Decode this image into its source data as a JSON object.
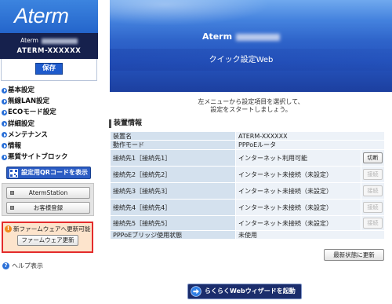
{
  "sidebar": {
    "logo": "Aterm",
    "device_brand": "Aterm",
    "device_id": "ATERM-XXXXXX",
    "save_label": "保存",
    "menu": [
      {
        "label": "基本設定",
        "icon": "circle-arrow-icon"
      },
      {
        "label": "無線LAN設定",
        "icon": "circle-arrow-icon"
      },
      {
        "label": "ECOモード設定",
        "icon": "circle-arrow-icon"
      },
      {
        "label": "詳細設定",
        "icon": "circle-arrow-icon"
      },
      {
        "label": "メンテナンス",
        "icon": "circle-arrow-icon"
      },
      {
        "label": "情報",
        "icon": "circle-arrow-icon"
      },
      {
        "label": "悪質サイトブロック",
        "icon": "circle-arrow-icon"
      }
    ],
    "qr_button": {
      "label": "設定用QRコードを表示",
      "icon": "qr-code-icon"
    },
    "aterm_station_button": "AtermStation",
    "customer_registration_button": "お客様登録",
    "firmware": {
      "icon_glyph": "!",
      "notice": "新ファームウェアへ更新可能",
      "button": "ファームウェア更新"
    },
    "help": {
      "icon_glyph": "?",
      "label": "ヘルプ表示"
    }
  },
  "header": {
    "brand": "Aterm",
    "subtitle": "クイック設定Web"
  },
  "main": {
    "intro": [
      "左メニューから設定項目を選択して、",
      "設定をスタートしましょう。"
    ],
    "device_info": {
      "title": "装置情報",
      "rows": [
        {
          "label": "装置名",
          "value": "ATERM-XXXXXX"
        },
        {
          "label": "動作モード",
          "value": "PPPoEルータ"
        },
        {
          "label": "接続先1［接続先1］",
          "value": "インターネット利用可能",
          "action": "切断",
          "action_enabled": true
        },
        {
          "label": "接続先2［接続先2］",
          "value": "インターネット未接続（未設定）",
          "action": "接続",
          "action_enabled": false
        },
        {
          "label": "接続先3［接続先3］",
          "value": "インターネット未接続（未設定）",
          "action": "接続",
          "action_enabled": false
        },
        {
          "label": "接続先4［接続先4］",
          "value": "インターネット未接続（未設定）",
          "action": "接続",
          "action_enabled": false
        },
        {
          "label": "接続先5［接続先5］",
          "value": "インターネット未接続（未設定）",
          "action": "接続",
          "action_enabled": false
        },
        {
          "label": "PPPoEブリッジ使用状態",
          "value": "未使用"
        }
      ]
    },
    "refresh_button": "最新状態に更新",
    "wizard_button": {
      "label": "らくらくWebウィザードを起動",
      "icon": "circle-arrow-icon"
    }
  },
  "colors": {
    "brand_blue": "#2465cb",
    "sidebar_dark": "#16214d",
    "alert_border": "#e32b2b",
    "alert_bg": "#fde4cc",
    "table_label_bg": "#d4e1ee",
    "table_value_bg": "#edf2f8",
    "wizard_bg": "#1b2d6c"
  }
}
